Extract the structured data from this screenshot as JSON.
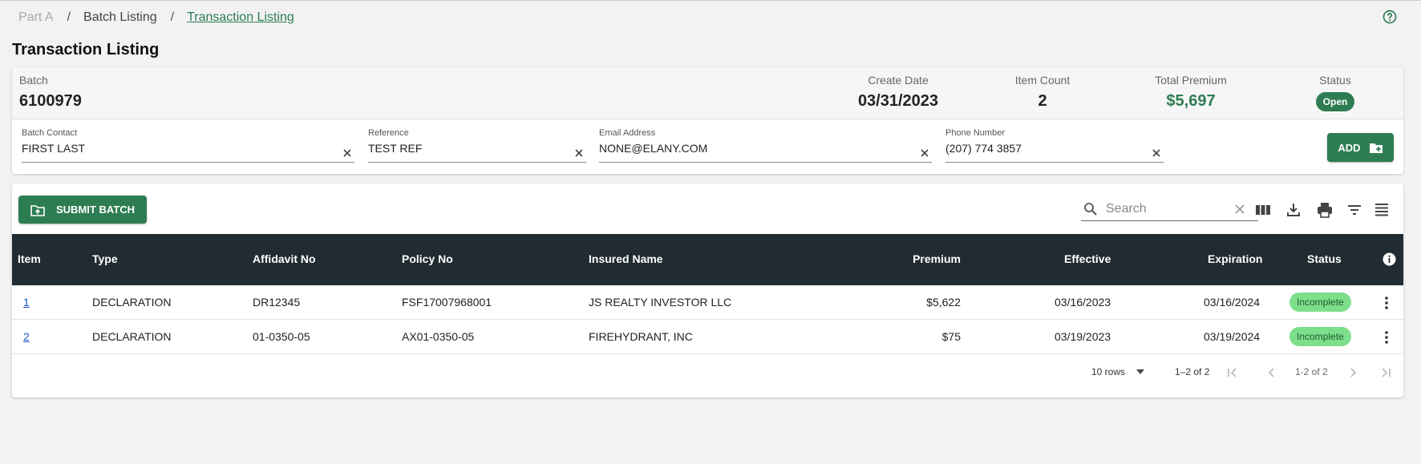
{
  "breadcrumb": {
    "items": [
      {
        "label": "Part A"
      },
      {
        "label": "Batch Listing"
      },
      {
        "label": "Transaction Listing"
      }
    ],
    "separator": "/"
  },
  "page": {
    "title": "Transaction Listing"
  },
  "batch": {
    "batch_label": "Batch",
    "batch_value": "6100979",
    "create_date_label": "Create Date",
    "create_date_value": "03/31/2023",
    "item_count_label": "Item Count",
    "item_count_value": "2",
    "total_premium_label": "Total Premium",
    "total_premium_value": "$5,697",
    "status_label": "Status",
    "status_value": "Open"
  },
  "fields": {
    "contact": {
      "label": "Batch Contact",
      "value": "FIRST LAST"
    },
    "reference": {
      "label": "Reference",
      "value": "TEST REF"
    },
    "email": {
      "label": "Email Address",
      "value": "NONE@ELANY.COM"
    },
    "phone": {
      "label": "Phone Number",
      "value": "(207) 774 3857"
    }
  },
  "actions": {
    "add_label": "ADD",
    "submit_label": "SUBMIT BATCH"
  },
  "search": {
    "placeholder": "Search"
  },
  "table": {
    "headers": {
      "item": "Item",
      "type": "Type",
      "affidavit": "Affidavit No",
      "policy": "Policy No",
      "insured": "Insured Name",
      "premium": "Premium",
      "effective": "Effective",
      "expiration": "Expiration",
      "status": "Status"
    },
    "rows": [
      {
        "item": "1",
        "type": "DECLARATION",
        "affidavit": "DR12345",
        "policy": "FSF17007968001",
        "insured": "JS REALTY INVESTOR LLC",
        "premium": "$5,622",
        "effective": "03/16/2023",
        "expiration": "03/16/2024",
        "status": "Incomplete"
      },
      {
        "item": "2",
        "type": "DECLARATION",
        "affidavit": "01-0350-05",
        "policy": "AX01-0350-05",
        "insured": "FIREHYDRANT, INC",
        "premium": "$75",
        "effective": "03/19/2023",
        "expiration": "03/19/2024",
        "status": "Incomplete"
      }
    ]
  },
  "pagination": {
    "rows_per_page": "10 rows",
    "range_text": "1–2 of 2",
    "range_short": "1-2 of 2"
  },
  "colors": {
    "brand_green": "#2e7d52",
    "header_dark": "#212b32",
    "badge_green": "#7ddf8c",
    "link_blue": "#1a57c9"
  },
  "icons": [
    "help-circle-icon",
    "close-icon",
    "folder-plus-icon",
    "folder-upload-icon",
    "search-icon",
    "columns-icon",
    "download-icon",
    "print-icon",
    "filter-icon",
    "density-icon",
    "info-icon",
    "more-vertical-icon",
    "chevron-down-icon",
    "first-page-icon",
    "previous-page-icon",
    "next-page-icon",
    "last-page-icon"
  ]
}
